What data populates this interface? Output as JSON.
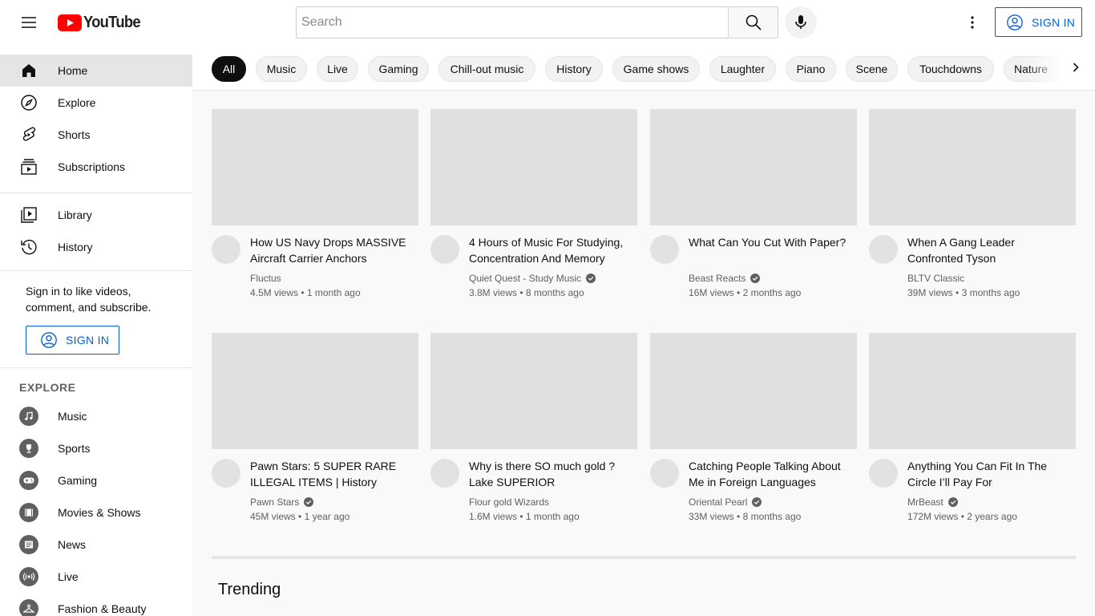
{
  "header": {
    "logo_text": "YouTube",
    "search_placeholder": "Search",
    "sign_in_label": "SIGN IN"
  },
  "sidebar": {
    "main_items": [
      {
        "label": "Home",
        "icon": "home-icon"
      },
      {
        "label": "Explore",
        "icon": "compass-icon"
      },
      {
        "label": "Shorts",
        "icon": "shorts-icon"
      },
      {
        "label": "Subscriptions",
        "icon": "subscriptions-icon"
      }
    ],
    "library_items": [
      {
        "label": "Library",
        "icon": "library-icon"
      },
      {
        "label": "History",
        "icon": "history-icon"
      }
    ],
    "signin_prompt": "Sign in to like videos, comment, and subscribe.",
    "sign_in_label": "SIGN IN",
    "explore_heading": "EXPLORE",
    "explore_items": [
      {
        "label": "Music",
        "icon": "music-note-icon"
      },
      {
        "label": "Sports",
        "icon": "trophy-icon"
      },
      {
        "label": "Gaming",
        "icon": "gamepad-icon"
      },
      {
        "label": "Movies & Shows",
        "icon": "film-icon"
      },
      {
        "label": "News",
        "icon": "newspaper-icon"
      },
      {
        "label": "Live",
        "icon": "live-broadcast-icon"
      },
      {
        "label": "Fashion & Beauty",
        "icon": "hanger-icon"
      }
    ]
  },
  "chips": [
    "All",
    "Music",
    "Live",
    "Gaming",
    "Chill-out music",
    "History",
    "Game shows",
    "Laughter",
    "Piano",
    "Scene",
    "Touchdowns",
    "Nature"
  ],
  "videos": [
    {
      "title": "How US Navy Drops MASSIVE Aircraft Carrier Anchors",
      "channel": "Fluctus",
      "verified": false,
      "views": "4.5M views",
      "age": "1 month ago"
    },
    {
      "title": "4 Hours of Music For Studying, Concentration And Memory",
      "channel": "Quiet Quest - Study Music",
      "verified": true,
      "views": "3.8M views",
      "age": "8 months ago"
    },
    {
      "title": "What Can You Cut With Paper?",
      "channel": "Beast Reacts",
      "verified": true,
      "views": "16M views",
      "age": "2 months ago"
    },
    {
      "title": "When A Gang Leader Confronted Tyson",
      "channel": "BLTV Classic",
      "verified": false,
      "views": "39M views",
      "age": "3 months ago"
    },
    {
      "title": "Pawn Stars: 5 SUPER RARE ILLEGAL ITEMS | History",
      "channel": "Pawn Stars",
      "verified": true,
      "views": "45M views",
      "age": "1 year ago"
    },
    {
      "title": "Why is there SO much gold ? Lake SUPERIOR",
      "channel": "Flour gold Wizards",
      "verified": false,
      "views": "1.6M views",
      "age": "1 month ago"
    },
    {
      "title": "Catching People Talking About Me in Foreign Languages",
      "channel": "Oriental Pearl",
      "verified": true,
      "views": "33M views",
      "age": "8 months ago"
    },
    {
      "title": "Anything You Can Fit In The Circle I’ll Pay For",
      "channel": "MrBeast",
      "verified": true,
      "views": "172M views",
      "age": "2 years ago"
    }
  ],
  "trending_heading": "Trending",
  "meta_separator": "•"
}
